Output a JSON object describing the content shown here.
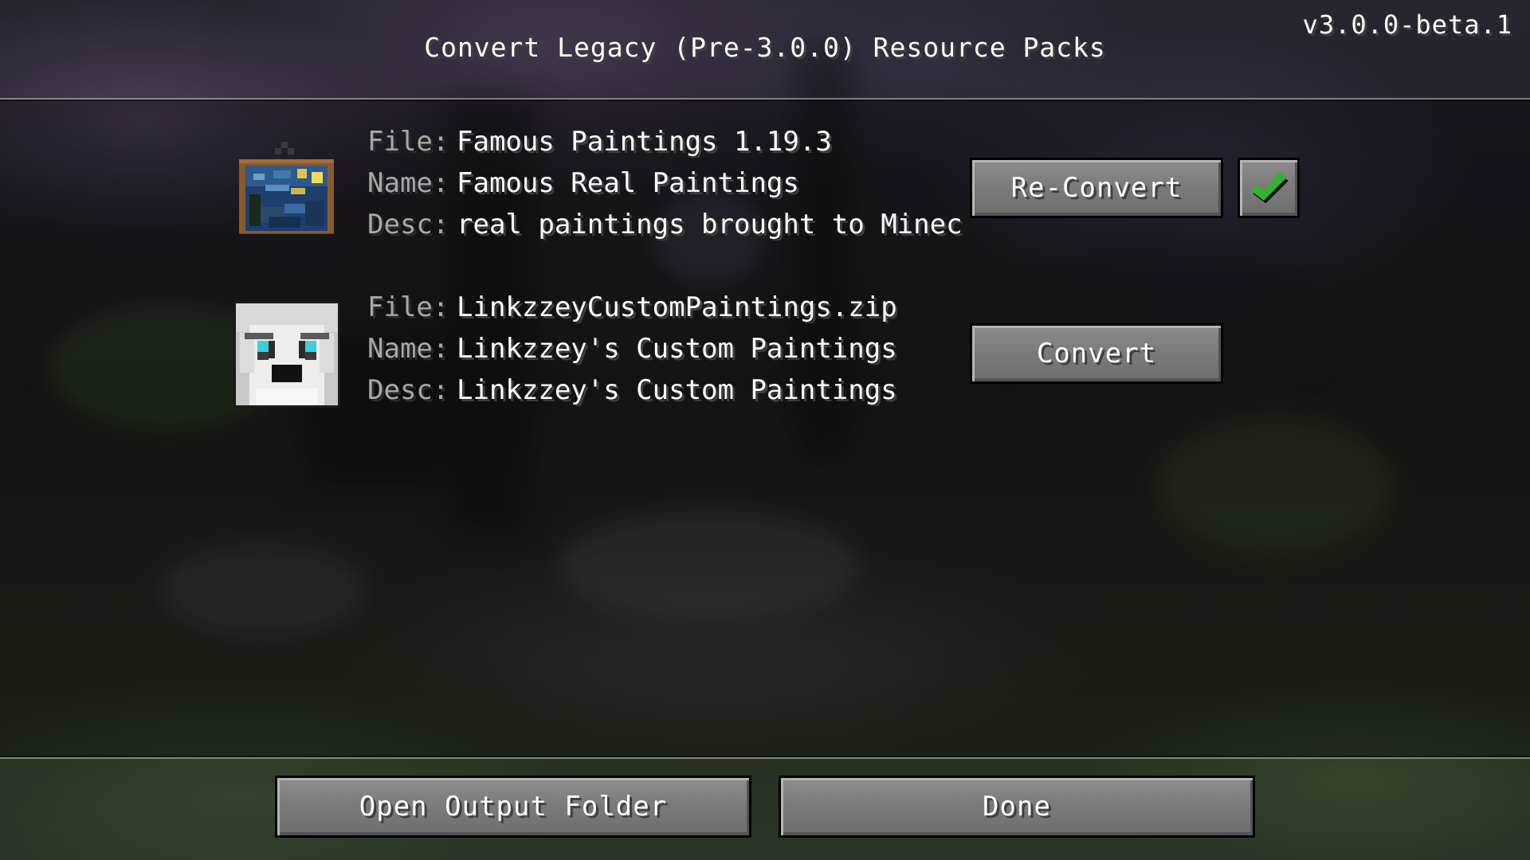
{
  "screen": {
    "title": "Convert Legacy (Pre-3.0.0) Resource Packs",
    "version": "v3.0.0-beta.1"
  },
  "packs": [
    {
      "file_label": "File:",
      "file": "Famous Paintings 1.19.3",
      "name_label": "Name:",
      "name": "Famous Real Paintings",
      "desc_label": "Desc:",
      "desc": "real paintings brought to Minec",
      "icon": "starry-night-painting-icon",
      "button_label": "Re-Convert",
      "status_icon": "checkmark-icon",
      "status_color": "#2fb52f"
    },
    {
      "file_label": "File:",
      "file": "LinkzzeyCustomPaintings.zip",
      "name_label": "Name:",
      "name": "Linkzzey's Custom Paintings",
      "desc_label": "Desc:",
      "desc": "Linkzzey's Custom Paintings",
      "icon": "linkzzey-avatar-icon",
      "button_label": "Convert"
    }
  ],
  "footer": {
    "open_output_label": "Open Output Folder",
    "done_label": "Done"
  }
}
